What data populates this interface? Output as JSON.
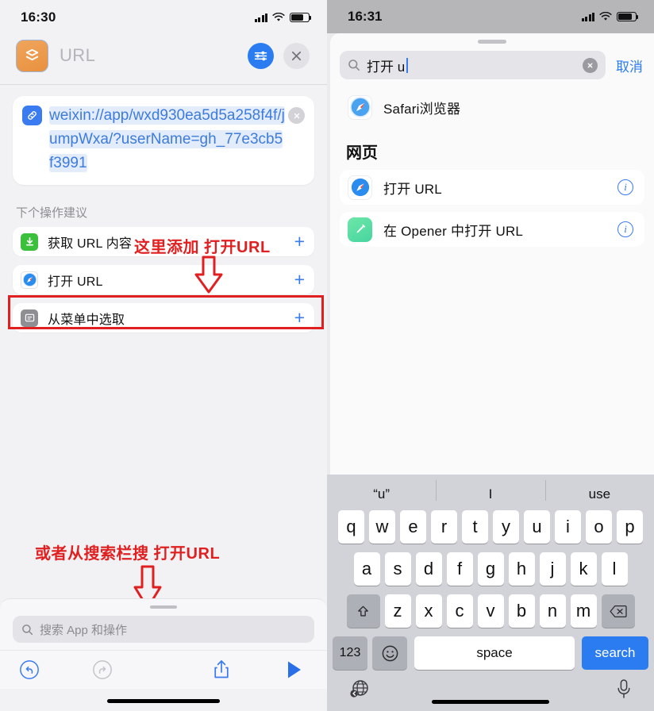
{
  "left_phone": {
    "status": {
      "time": "16:30"
    },
    "header": {
      "app_icon": "shortcuts-stack-icon",
      "title": "URL",
      "settings_icon": "sliders-icon",
      "close_icon": "close-icon"
    },
    "url_card": {
      "link_icon": "link-icon",
      "url_text": "weixin://app/wxd930ea5d5a258f4f/jumpWxa/?userName=gh_77e3cb5f3991",
      "clear_icon": "clear-circle-icon"
    },
    "suggestions": {
      "section_label": "下个操作建议",
      "items": [
        {
          "icon": "download-icon",
          "label": "获取 URL 内容",
          "add": "+"
        },
        {
          "icon": "safari-icon",
          "label": "打开 URL",
          "add": "+"
        },
        {
          "icon": "menu-list-icon",
          "label": "从菜单中选取",
          "add": "+"
        }
      ]
    },
    "annotations": [
      {
        "text": "这里添加 打开URL"
      },
      {
        "text": "或者从搜索栏搜 打开URL"
      }
    ],
    "search": {
      "icon": "search-icon",
      "placeholder": "搜索 App 和操作"
    },
    "toolbar": {
      "undo_icon": "undo-icon",
      "redo_icon": "redo-icon",
      "share_icon": "share-icon",
      "run_icon": "play-icon"
    }
  },
  "right_phone": {
    "status": {
      "time": "16:31"
    },
    "search": {
      "icon": "search-icon",
      "value": "打开 u",
      "clear_icon": "clear-circle-icon",
      "cancel_label": "取消"
    },
    "results": {
      "app_row": {
        "icon": "safari-icon",
        "label": "Safari浏览器"
      },
      "group_title": "网页",
      "items": [
        {
          "icon": "safari-icon",
          "label": "打开 URL",
          "info_icon": "info-icon"
        },
        {
          "icon": "opener-pen-icon",
          "label": "在 Opener 中打开 URL",
          "info_icon": "info-icon"
        }
      ]
    },
    "keyboard": {
      "predictions": [
        "“u”",
        "I",
        "use"
      ],
      "row1": [
        "q",
        "w",
        "e",
        "r",
        "t",
        "y",
        "u",
        "i",
        "o",
        "p"
      ],
      "row2": [
        "a",
        "s",
        "d",
        "f",
        "g",
        "h",
        "j",
        "k",
        "l"
      ],
      "row3_left_icon": "shift-icon",
      "row3": [
        "z",
        "x",
        "c",
        "v",
        "b",
        "n",
        "m"
      ],
      "row3_right_icon": "backspace-icon",
      "numeric_label": "123",
      "emoji_icon": "emoji-icon",
      "space_label": "space",
      "search_label": "search",
      "globe_icon": "globe-icon",
      "mic_icon": "microphone-icon"
    }
  },
  "colors": {
    "accent_blue": "#2b7cf0",
    "annotation_red": "#e02020",
    "app_orange": "#e8913f"
  }
}
